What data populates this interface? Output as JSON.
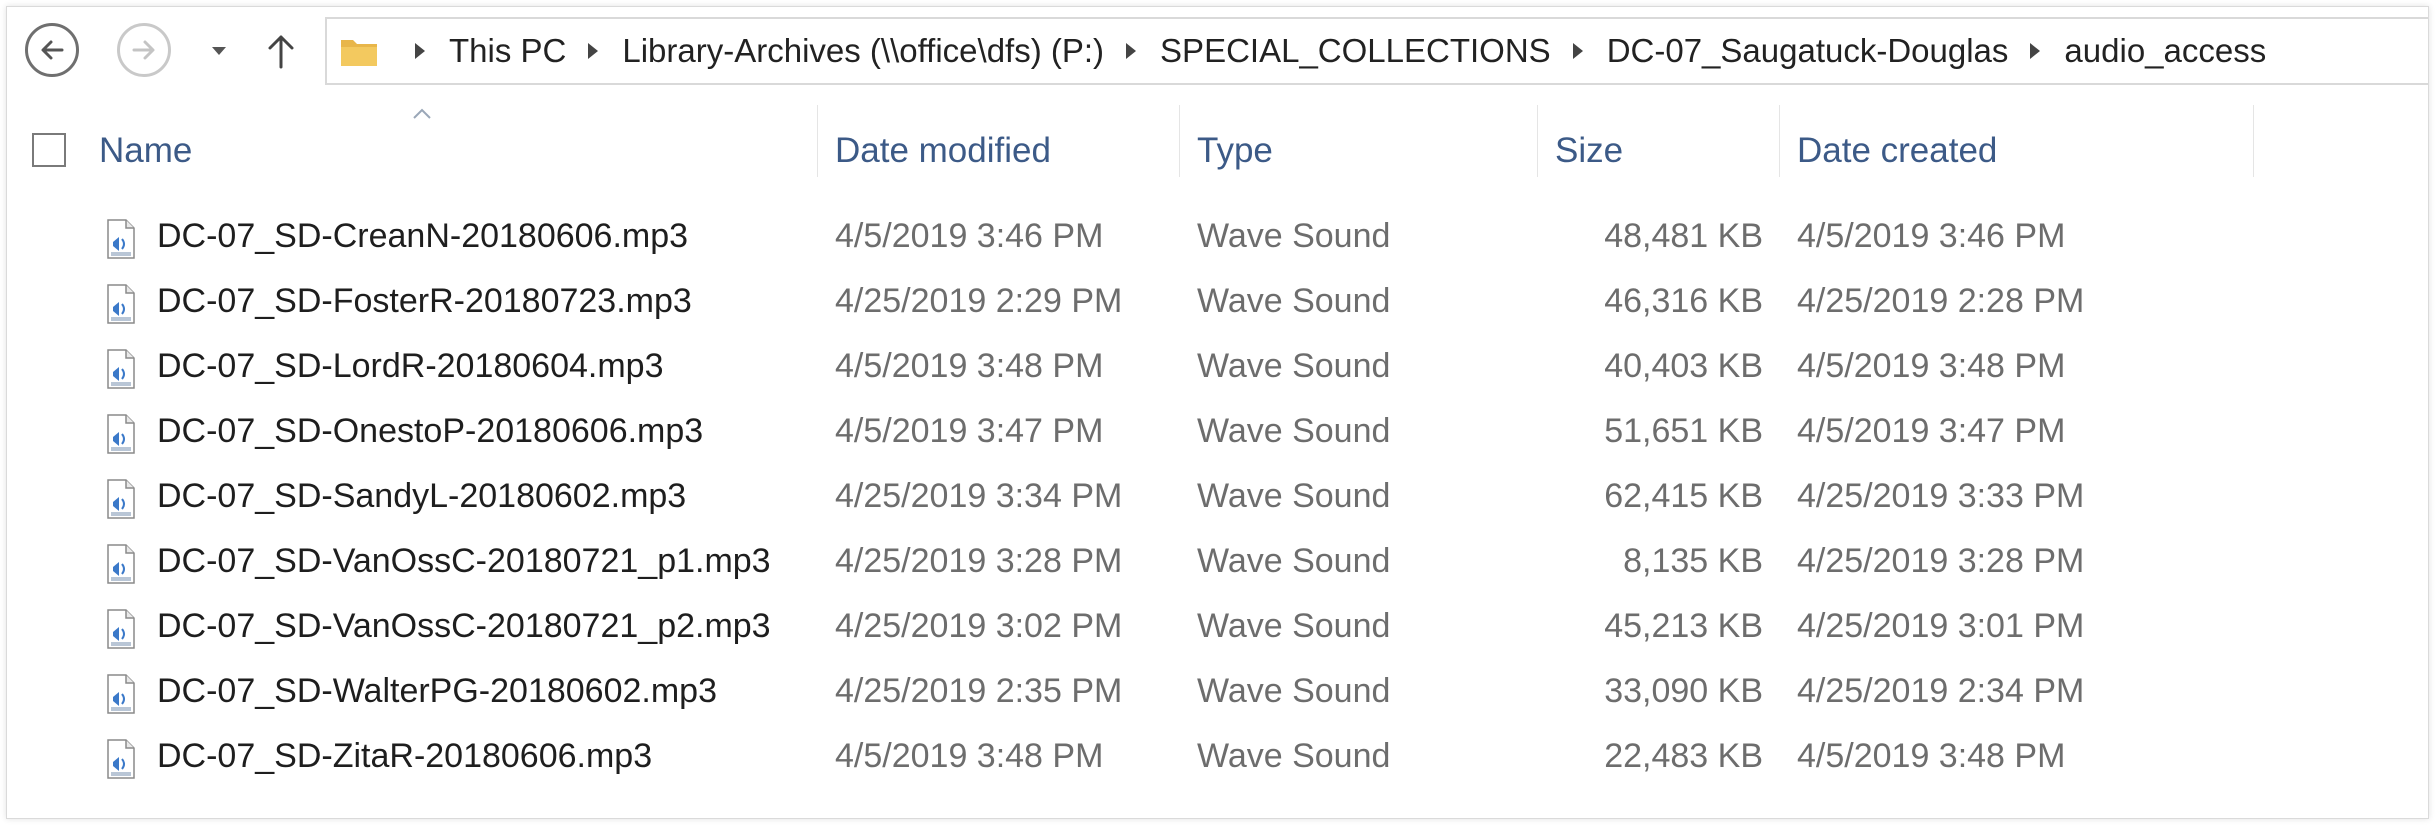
{
  "breadcrumbs": [
    "This PC",
    "Library-Archives (\\\\office\\dfs) (P:)",
    "SPECIAL_COLLECTIONS",
    "DC-07_Saugatuck-Douglas",
    "audio_access"
  ],
  "columns": {
    "name": "Name",
    "date_modified": "Date modified",
    "type": "Type",
    "size": "Size",
    "date_created": "Date created"
  },
  "files": [
    {
      "name": "DC-07_SD-CreanN-20180606.mp3",
      "date_modified": "4/5/2019 3:46 PM",
      "type": "Wave Sound",
      "size": "48,481 KB",
      "date_created": "4/5/2019 3:46 PM"
    },
    {
      "name": "DC-07_SD-FosterR-20180723.mp3",
      "date_modified": "4/25/2019 2:29 PM",
      "type": "Wave Sound",
      "size": "46,316 KB",
      "date_created": "4/25/2019 2:28 PM"
    },
    {
      "name": "DC-07_SD-LordR-20180604.mp3",
      "date_modified": "4/5/2019 3:48 PM",
      "type": "Wave Sound",
      "size": "40,403 KB",
      "date_created": "4/5/2019 3:48 PM"
    },
    {
      "name": "DC-07_SD-OnestoP-20180606.mp3",
      "date_modified": "4/5/2019 3:47 PM",
      "type": "Wave Sound",
      "size": "51,651 KB",
      "date_created": "4/5/2019 3:47 PM"
    },
    {
      "name": "DC-07_SD-SandyL-20180602.mp3",
      "date_modified": "4/25/2019 3:34 PM",
      "type": "Wave Sound",
      "size": "62,415 KB",
      "date_created": "4/25/2019 3:33 PM"
    },
    {
      "name": "DC-07_SD-VanOssC-20180721_p1.mp3",
      "date_modified": "4/25/2019 3:28 PM",
      "type": "Wave Sound",
      "size": "8,135 KB",
      "date_created": "4/25/2019 3:28 PM"
    },
    {
      "name": "DC-07_SD-VanOssC-20180721_p2.mp3",
      "date_modified": "4/25/2019 3:02 PM",
      "type": "Wave Sound",
      "size": "45,213 KB",
      "date_created": "4/25/2019 3:01 PM"
    },
    {
      "name": "DC-07_SD-WalterPG-20180602.mp3",
      "date_modified": "4/25/2019 2:35 PM",
      "type": "Wave Sound",
      "size": "33,090 KB",
      "date_created": "4/25/2019 2:34 PM"
    },
    {
      "name": "DC-07_SD-ZitaR-20180606.mp3",
      "date_modified": "4/5/2019 3:48 PM",
      "type": "Wave Sound",
      "size": "22,483 KB",
      "date_created": "4/5/2019 3:48 PM"
    }
  ],
  "icons": {
    "back": "back-arrow-icon",
    "forward": "forward-arrow-icon",
    "recent": "chevron-down-icon",
    "up": "up-arrow-icon",
    "folder": "folder-icon",
    "file": "wav-file-icon"
  },
  "colors": {
    "header_text": "#3c5a87",
    "secondary_text": "#6d6d6d",
    "folder": "#e8b64a"
  }
}
